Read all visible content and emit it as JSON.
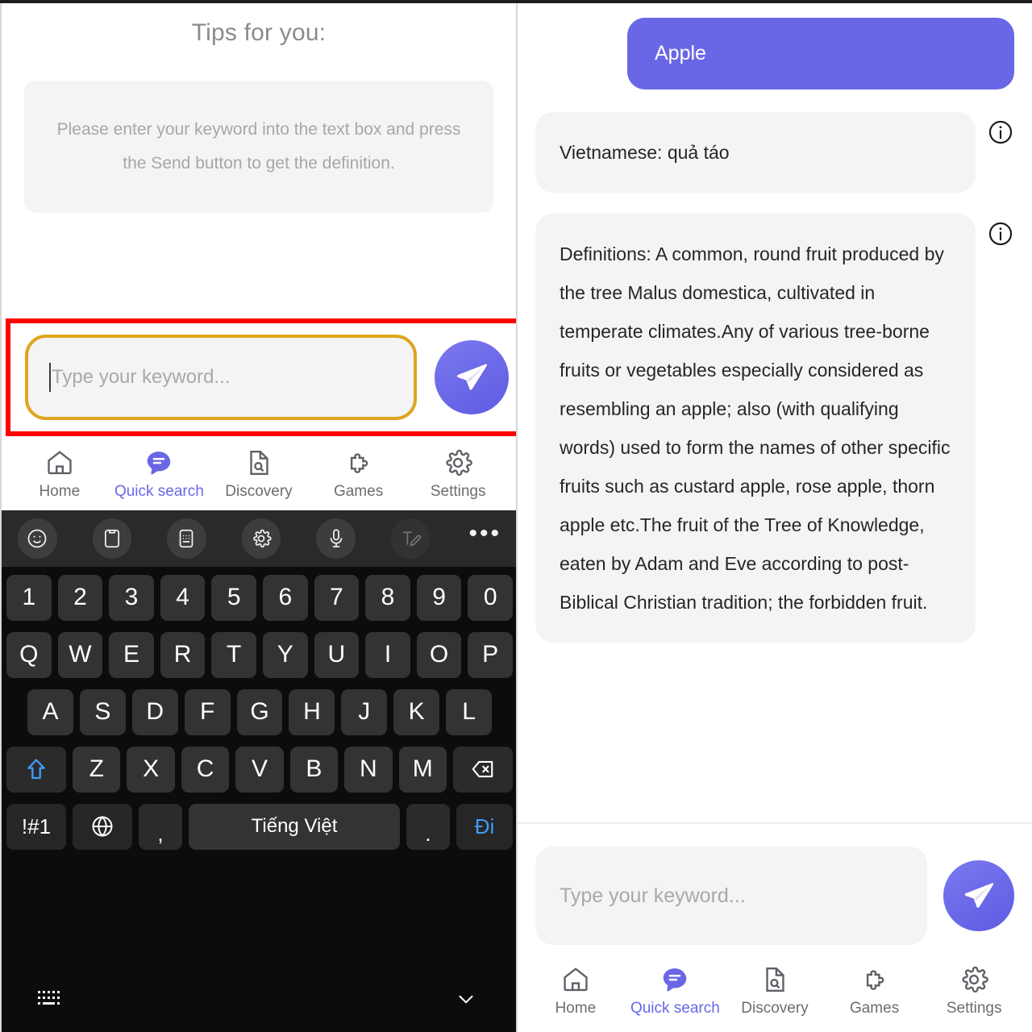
{
  "left_panel": {
    "tips_title": "Tips for you:",
    "tips_text": "Please enter your keyword into the text box and press the Send button to get the definition.",
    "composer": {
      "placeholder": "Type your keyword...",
      "value": "",
      "send_icon": "send-paper-plane-icon",
      "highlight_color": "#fe0000",
      "focus_border_color": "#dfa41f"
    },
    "nav": {
      "items": [
        {
          "label": "Home",
          "icon": "home-icon",
          "active": false
        },
        {
          "label": "Quick search",
          "icon": "chat-bubble-icon",
          "active": true
        },
        {
          "label": "Discovery",
          "icon": "document-search-icon",
          "active": false
        },
        {
          "label": "Games",
          "icon": "puzzle-piece-icon",
          "active": false
        },
        {
          "label": "Settings",
          "icon": "gear-icon",
          "active": false
        }
      ],
      "active_color": "#6a67e6"
    }
  },
  "keyboard": {
    "toolbar": [
      {
        "name": "emoji-icon",
        "dim": false
      },
      {
        "name": "clipboard-icon",
        "dim": false
      },
      {
        "name": "keyboard-panel-icon",
        "dim": false
      },
      {
        "name": "gear-icon",
        "dim": false
      },
      {
        "name": "microphone-icon",
        "dim": false
      },
      {
        "name": "text-edit-icon",
        "dim": true
      }
    ],
    "more_label": "•••",
    "row_numbers": [
      "1",
      "2",
      "3",
      "4",
      "5",
      "6",
      "7",
      "8",
      "9",
      "0"
    ],
    "row_top": [
      "Q",
      "W",
      "E",
      "R",
      "T",
      "Y",
      "U",
      "I",
      "O",
      "P"
    ],
    "row_mid": [
      "A",
      "S",
      "D",
      "F",
      "G",
      "H",
      "J",
      "K",
      "L"
    ],
    "row_low": [
      "Z",
      "X",
      "C",
      "V",
      "B",
      "N",
      "M"
    ],
    "shift_icon": "shift-arrow-icon",
    "backspace_icon": "backspace-icon",
    "bottom_row": {
      "symbols_label": "!#1",
      "globe_icon": "globe-icon",
      "comma_label": ",",
      "space_label": "Tiếng Việt",
      "period_label": ".",
      "go_label": "Đi",
      "go_color": "#3f9cf5"
    },
    "nav_bar": {
      "keyboard_icon": "keyboard-icon",
      "hide_icon": "chevron-down-icon"
    }
  },
  "right_panel": {
    "messages": [
      {
        "role": "user",
        "text": "Apple",
        "bubble_color": "#6a67e6"
      },
      {
        "role": "bot",
        "text": "Vietnamese: quả táo",
        "info_icon": "info-circle-icon"
      },
      {
        "role": "bot",
        "text": "Definitions: A common, round fruit produced by the tree Malus domestica, cultivated in temperate climates.Any of various tree-borne fruits or vegetables especially considered as resembling an apple; also (with qualifying words) used to form the names of other specific fruits such as custard apple, rose apple, thorn apple etc.The fruit of the Tree of Knowledge, eaten by Adam and Eve according to post-Biblical Christian tradition; the forbidden fruit.",
        "info_icon": "info-circle-icon",
        "clipped": true
      }
    ],
    "composer": {
      "placeholder": "Type your keyword...",
      "value": "",
      "send_icon": "send-paper-plane-icon"
    },
    "nav": {
      "items": [
        {
          "label": "Home",
          "icon": "home-icon",
          "active": false
        },
        {
          "label": "Quick search",
          "icon": "chat-bubble-icon",
          "active": true
        },
        {
          "label": "Discovery",
          "icon": "document-search-icon",
          "active": false
        },
        {
          "label": "Games",
          "icon": "puzzle-piece-icon",
          "active": false
        },
        {
          "label": "Settings",
          "icon": "gear-icon",
          "active": false
        }
      ],
      "active_color": "#6a67e6"
    }
  }
}
